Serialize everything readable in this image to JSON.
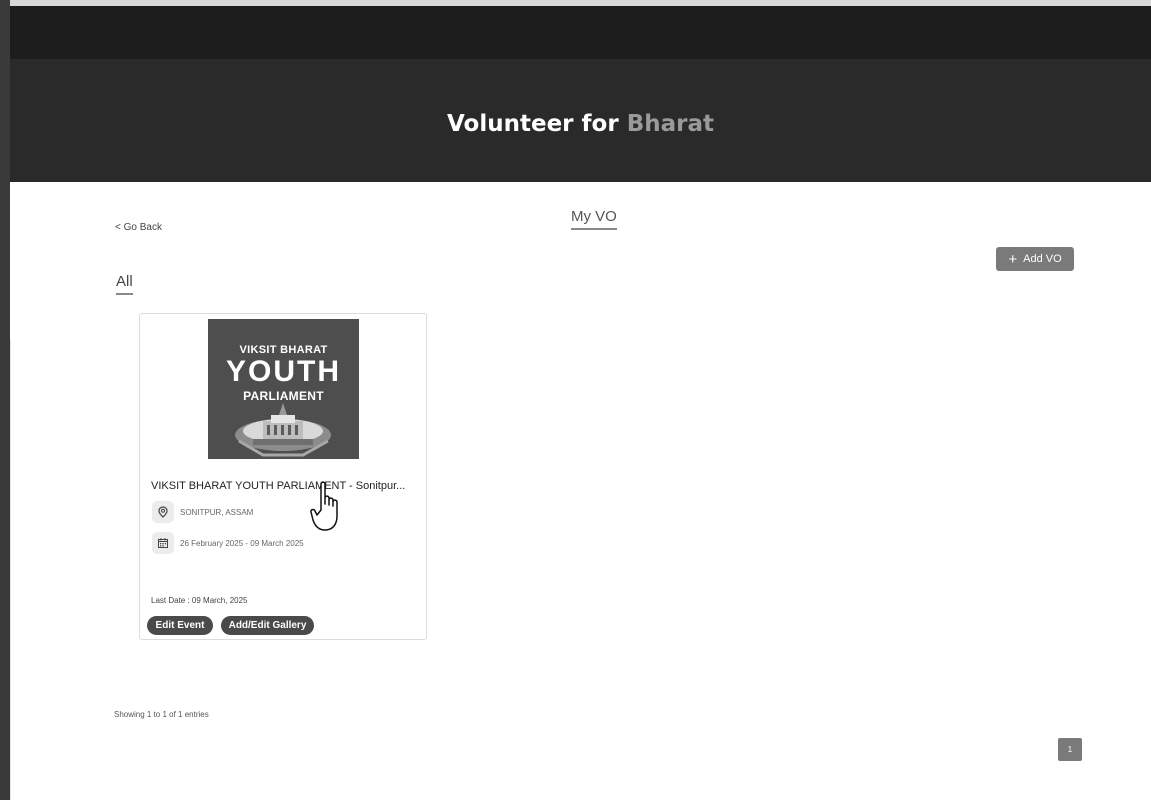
{
  "header": {
    "title_main": "Volunteer for",
    "title_accent": "Bharat"
  },
  "nav": {
    "go_back": "< Go Back",
    "page_title": "My VO",
    "add_button": "Add VO",
    "add_icon": "plus-icon"
  },
  "tabs": [
    {
      "label": "All",
      "active": true
    }
  ],
  "cards": [
    {
      "image": {
        "line1": "VIKSIT BHARAT",
        "line2": "YOUTH",
        "line3": "PARLIAMENT"
      },
      "title": "VIKSIT BHARAT YOUTH PARLIAMENT - Sonitpur...",
      "location_icon": "location-pin-icon",
      "location": "SONITPUR, ASSAM",
      "date_icon": "calendar-icon",
      "date_range": "26 February 2025 - 09 March 2025",
      "last_date": "Last Date : 09 March, 2025",
      "actions": {
        "edit_event": "Edit Event",
        "add_edit_gallery": "Add/Edit Gallery"
      }
    }
  ],
  "footer": {
    "showing": "Showing 1 to 1 of 1 entries",
    "current_page": "1"
  },
  "colors": {
    "banner_bg": "#2a2a2a",
    "topbar_bg": "#1d1d1d",
    "accent_text": "#9a9a9a",
    "button_bg": "#7a7a7a",
    "chip_bg": "#4a4a4a"
  }
}
